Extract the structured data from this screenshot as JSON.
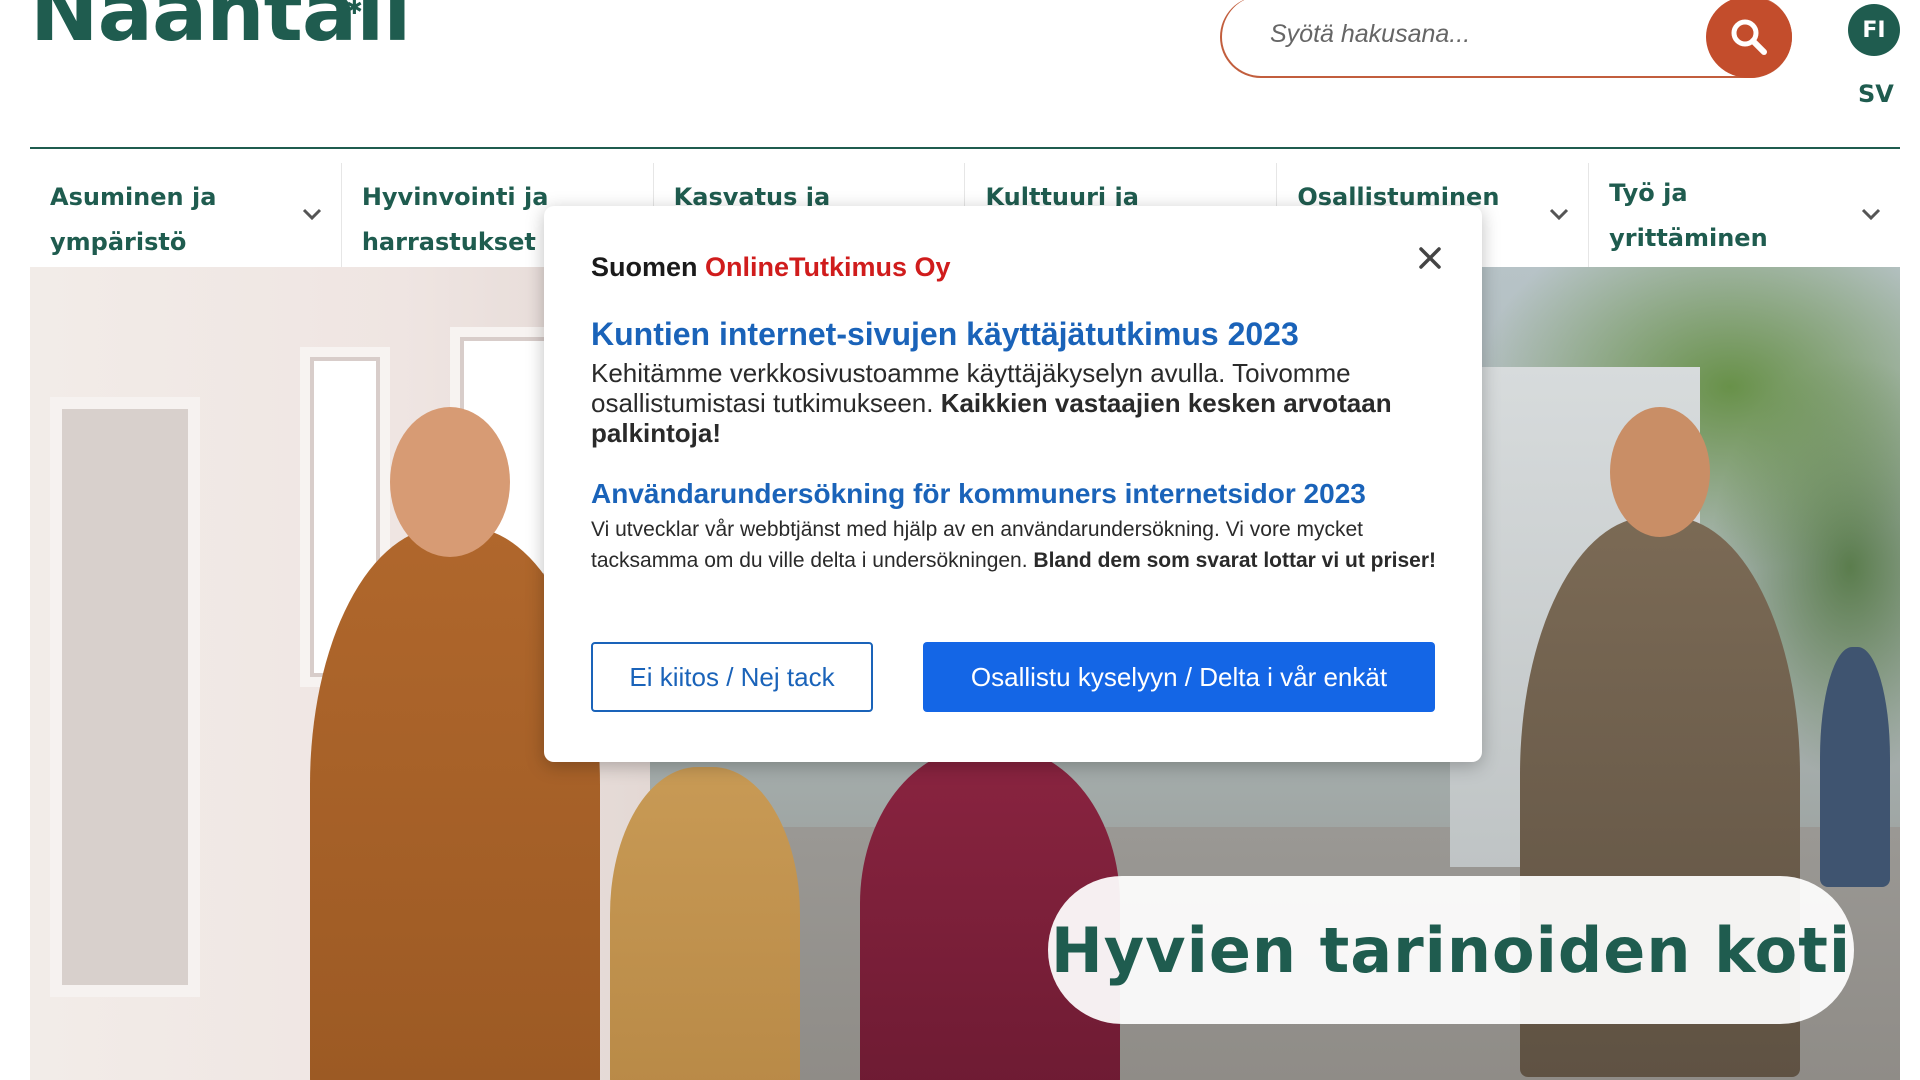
{
  "header": {
    "logo_text": "Naantali",
    "search_placeholder": "Syötä hakusana...",
    "lang_fi": "FI",
    "lang_sv": "SV"
  },
  "nav": {
    "items": [
      {
        "label": "Asuminen ja ympäristö"
      },
      {
        "label": "Hyvinvointi ja harrastukset"
      },
      {
        "label": "Kasvatus ja"
      },
      {
        "label": "Kulttuuri ja liikunta"
      },
      {
        "label": "Osallistuminen ja"
      },
      {
        "label": "Työ ja yrittäminen"
      }
    ]
  },
  "hero": {
    "tagline": "Hyvien tarinoiden koti"
  },
  "modal": {
    "brand_prefix": "Suomen ",
    "brand_red": "OnlineTutkimus Oy",
    "fi_title": "Kuntien internet-sivujen käyttäjätutkimus 2023",
    "fi_body": "Kehitämme verkkosivustoamme käyttäjäkyselyn avulla. Toivomme osallistumistasi tutkimukseen. ",
    "fi_body_bold": "Kaikkien vastaajien kesken arvotaan palkintoja!",
    "sv_title": "Användarundersökning för kommuners internetsidor 2023",
    "sv_body": "Vi utvecklar vår webbtjänst med hjälp av en användarundersökning. Vi vore mycket tacksamma om du ville delta i undersökningen. ",
    "sv_body_bold": "Bland dem som svarat lottar vi ut priser!",
    "decline_label": "Ei kiitos / Nej tack",
    "accept_label": "Osallistu kyselyyn / Delta i vår enkät"
  },
  "colors": {
    "brand_green": "#1f5c4f",
    "search_orange": "#c34d2c",
    "survey_blue": "#1466e6",
    "survey_red": "#d01c1c"
  }
}
